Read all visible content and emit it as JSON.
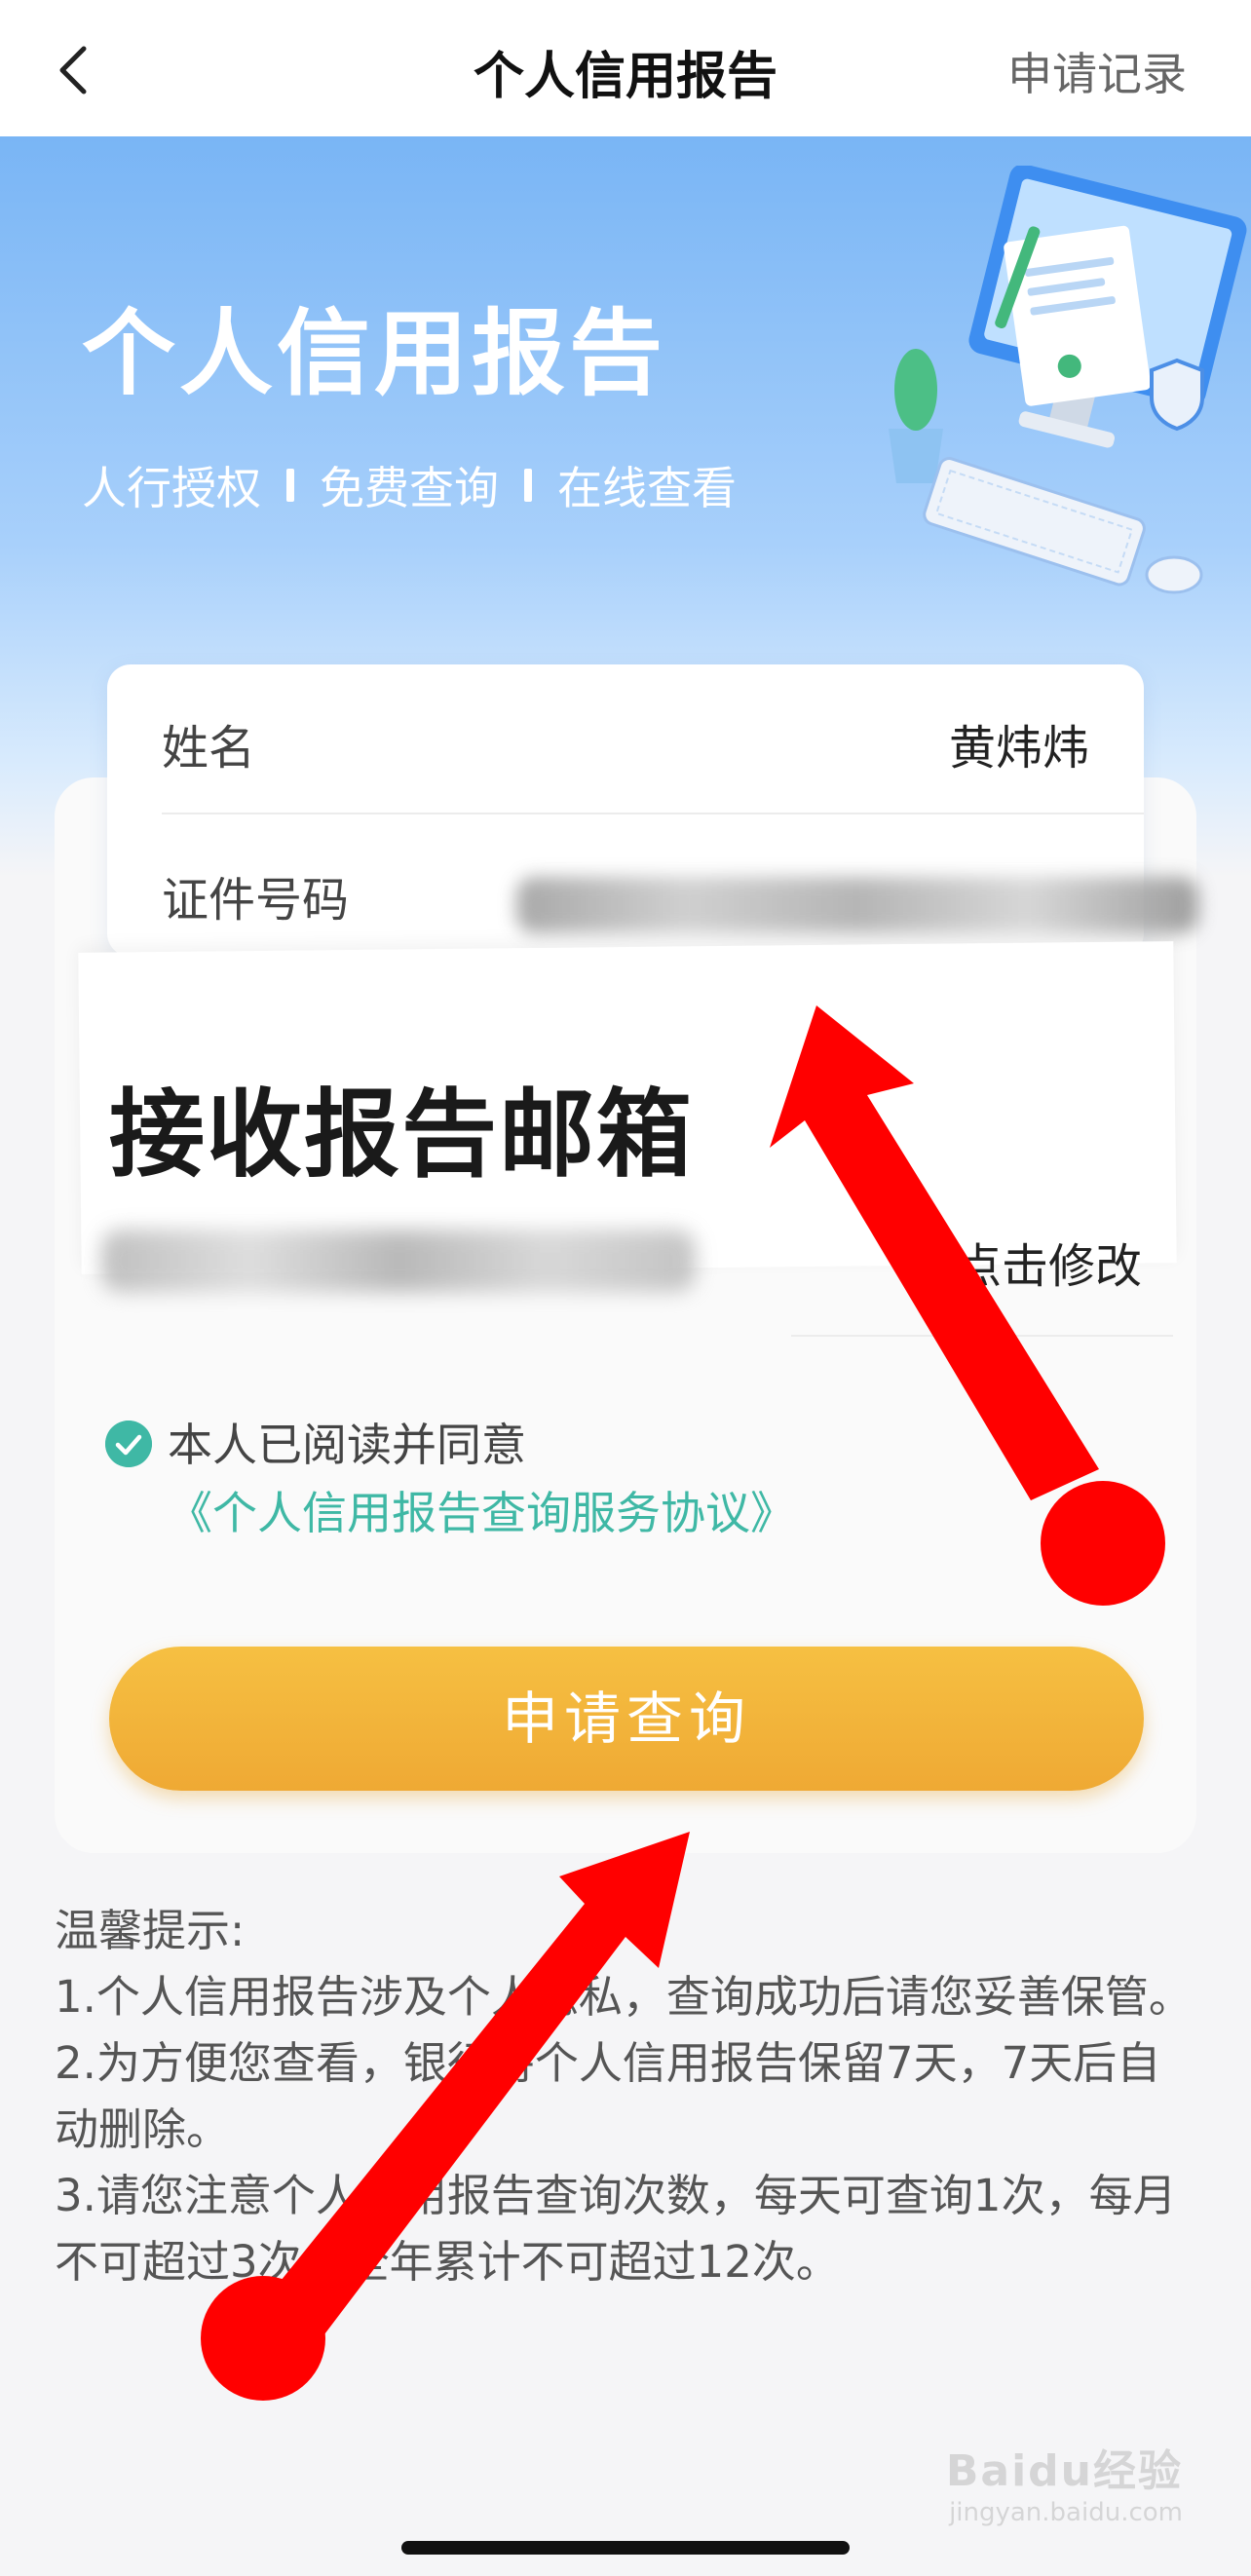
{
  "nav": {
    "title": "个人信用报告",
    "record_link": "申请记录"
  },
  "hero": {
    "title": "个人信用报告",
    "tags": [
      "人行授权",
      "免费查询",
      "在线查看"
    ]
  },
  "form": {
    "name_label": "姓名",
    "name_value": "黄炜炜",
    "id_label": "证件号码",
    "mailbox_title": "接收报告邮箱",
    "modify_link": "点击修改"
  },
  "agreement": {
    "prefix": "本人已阅读并同意 ",
    "link": "《个人信用报告查询服务协议》",
    "checked": true
  },
  "apply_button": "申请查询",
  "tips": {
    "heading": "温馨提示:",
    "items": [
      "1.个人信用报告涉及个人隐私，查询成功后请您妥善保管。",
      "2.为方便您查看，银行将个人信用报告保留7天，7天后自动删除。",
      "3.请您注意个人信用报告查询次数，每天可查询1次，每月不可超过3次，全年累计不可超过12次。"
    ]
  },
  "watermark": {
    "brand": "Baidu经验",
    "url": "jingyan.baidu.com"
  },
  "colors": {
    "accent_green": "#3fb8a5",
    "button_orange": "#f2b33a",
    "hero_blue": "#79b5f5",
    "annotation_red": "#ff0000"
  },
  "icons": [
    "back-arrow-icon",
    "check-circle-icon",
    "computer-illustration"
  ]
}
